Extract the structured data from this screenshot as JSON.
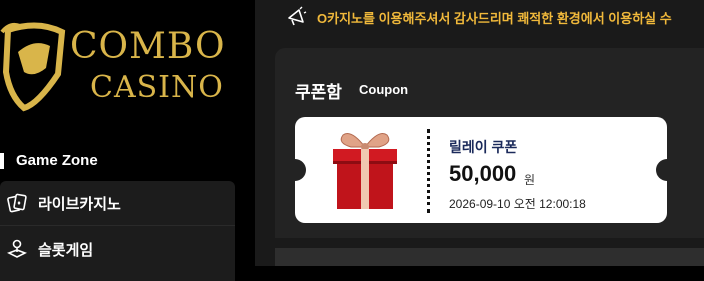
{
  "logo": {
    "line1": "COMBO",
    "line2": "CASINO",
    "brand_color": "#d9b54a"
  },
  "sidebar": {
    "section_title": "Game Zone",
    "items": [
      {
        "label": "라이브카지노",
        "icon": "cards-icon"
      },
      {
        "label": "슬롯게임",
        "icon": "joystick-icon"
      }
    ]
  },
  "notice": {
    "icon": "megaphone-icon",
    "text": "O카지노를 이용해주셔서 감사드리며 쾌적한 환경에서 이용하실 수"
  },
  "coupon_panel": {
    "title": "쿠폰함",
    "subtitle": "Coupon",
    "coupon": {
      "name": "릴레이 쿠폰",
      "amount": "50,000",
      "unit": "원",
      "date": "2026-09-10 오전 12:00:18",
      "icon": "gift-box-icon"
    }
  },
  "colors": {
    "accent": "#f1b93b",
    "coupon_name": "#1b2a5b",
    "gift_red": "#c0141b"
  }
}
